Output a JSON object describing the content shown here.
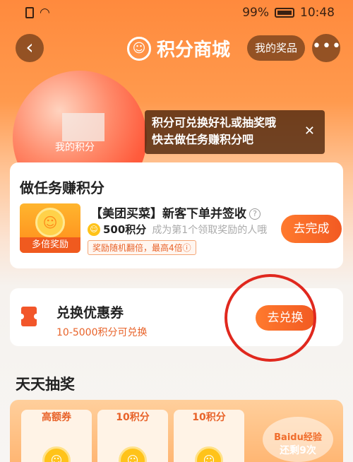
{
  "status": {
    "battery": "99%",
    "time": "10:48"
  },
  "nav": {
    "back": "<",
    "title": "积分商城",
    "title_icon": "meituan-logo-icon",
    "prizes_label": "我的奖品",
    "more_label": "•••"
  },
  "bubble": {
    "label": "我的积分"
  },
  "tooltip": {
    "line1": "积分可兑换好礼或抽奖哦",
    "line2": "快去做任务赚积分吧",
    "close": "✕"
  },
  "task": {
    "heading": "做任务赚积分",
    "thumb_tag": "多倍奖励",
    "title": "【美团买菜】新客下单并签收",
    "points": "500积分",
    "points_sub": "成为第1个领取奖励的人哦",
    "bonus": "奖励随机翻倍，最高4倍ⓘ",
    "button": "去完成"
  },
  "coupon": {
    "title": "兑换优惠券",
    "sub": "10-5000积分可兑换",
    "button": "去兑换"
  },
  "lottery": {
    "heading": "天天抽奖",
    "prizes": [
      "高额券",
      "10积分",
      "10积分"
    ],
    "remaining": "还剩9次",
    "watermark": "Baidu经验"
  },
  "colors": {
    "accent": "#f25a22",
    "bg_top": "#ff8a3d"
  }
}
